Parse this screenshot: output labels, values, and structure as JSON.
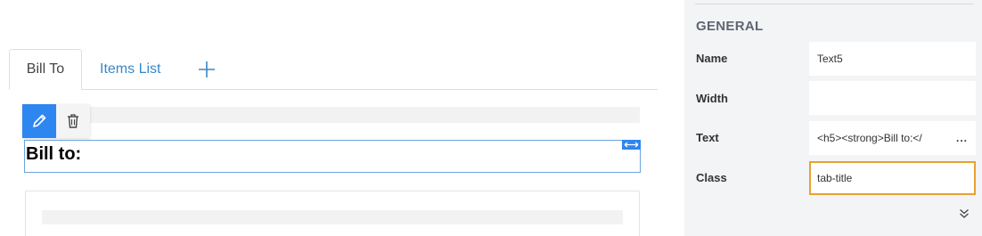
{
  "tabs": [
    {
      "label": "Bill To"
    },
    {
      "label": "Items List"
    }
  ],
  "selected_element": {
    "heading": "Bill to:"
  },
  "panel": {
    "section_title": "GENERAL",
    "props": {
      "name": {
        "label": "Name",
        "value": "Text5"
      },
      "width": {
        "label": "Width",
        "value": ""
      },
      "text": {
        "label": "Text",
        "value": "<h5><strong>Bill to:</",
        "more": "..."
      },
      "class": {
        "label": "Class",
        "value": "tab-title"
      }
    }
  },
  "colors": {
    "accent": "#2e86f0",
    "link": "#3a87c8",
    "focus": "#e9a12e"
  }
}
